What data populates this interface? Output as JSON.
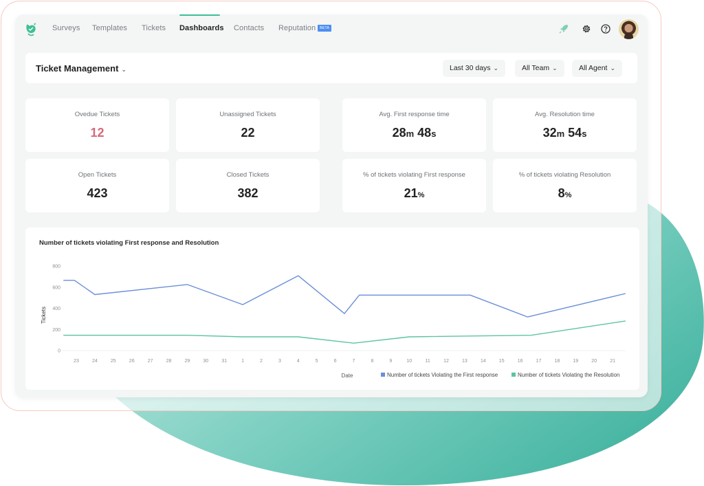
{
  "nav": {
    "tabs": [
      {
        "label": "Surveys",
        "active": false
      },
      {
        "label": "Templates",
        "active": false
      },
      {
        "label": "Tickets",
        "active": false
      },
      {
        "label": "Dashboards",
        "active": true
      },
      {
        "label": "Contacts",
        "active": false
      },
      {
        "label": "Reputation",
        "active": false,
        "badge": "BETA"
      }
    ],
    "icons": [
      "rocket-icon",
      "gear-icon",
      "help-icon"
    ],
    "brand_color": "#3fbf94"
  },
  "header": {
    "title": "Ticket Management",
    "filters": [
      "Last 30 days",
      "All Team",
      "All Agent"
    ]
  },
  "stats": {
    "overdue": {
      "label": "Ovedue Tickets",
      "value": "12"
    },
    "unassigned": {
      "label": "Unassigned Tickets",
      "value": "22"
    },
    "open": {
      "label": "Open Tickets",
      "value": "423"
    },
    "closed": {
      "label": "Closed Tickets",
      "value": "382"
    },
    "avg_first_response": {
      "label": "Avg. First response time",
      "min": "28",
      "min_unit": "m",
      "sec": "48",
      "sec_unit": "s"
    },
    "avg_resolution": {
      "label": "Avg. Resolution time",
      "min": "32",
      "min_unit": "m",
      "sec": "54",
      "sec_unit": "s"
    },
    "pct_first_response": {
      "label": "% of tickets violating First response",
      "value": "21",
      "unit": "%"
    },
    "pct_resolution": {
      "label": "% of tickets violating Resolution",
      "value": "8",
      "unit": "%"
    }
  },
  "chart_data": {
    "type": "line",
    "title": "Number of tickets violating First response and Resolution",
    "xlabel": "Date",
    "ylabel": "Tickets",
    "ylim": [
      0,
      800
    ],
    "yticks": [
      0,
      200,
      400,
      600,
      800
    ],
    "categories": [
      "23",
      "24",
      "25",
      "26",
      "27",
      "28",
      "29",
      "30",
      "31",
      "1",
      "2",
      "3",
      "4",
      "5",
      "6",
      "7",
      "8",
      "9",
      "10",
      "11",
      "12",
      "13",
      "14",
      "15",
      "16",
      "17",
      "18",
      "19",
      "20",
      "21"
    ],
    "legend_position": "bottom-right",
    "grid": false,
    "series": [
      {
        "name": "Number of tickets Violating the First response",
        "color": "#6b8fd8",
        "points": [
          [
            -0.7,
            665
          ],
          [
            -0.1,
            665
          ],
          [
            1,
            530
          ],
          [
            6,
            625
          ],
          [
            9,
            435
          ],
          [
            12,
            708
          ],
          [
            14.5,
            350
          ],
          [
            15.3,
            525
          ],
          [
            21.3,
            525
          ],
          [
            24.4,
            318
          ],
          [
            29.7,
            540
          ]
        ]
      },
      {
        "name": "Number of tickets Violating the Resolution",
        "color": "#5cc4a0",
        "points": [
          [
            -0.7,
            145
          ],
          [
            6,
            145
          ],
          [
            9,
            130
          ],
          [
            12,
            130
          ],
          [
            15,
            70
          ],
          [
            18,
            130
          ],
          [
            24.6,
            145
          ],
          [
            29.7,
            280
          ]
        ]
      }
    ]
  }
}
